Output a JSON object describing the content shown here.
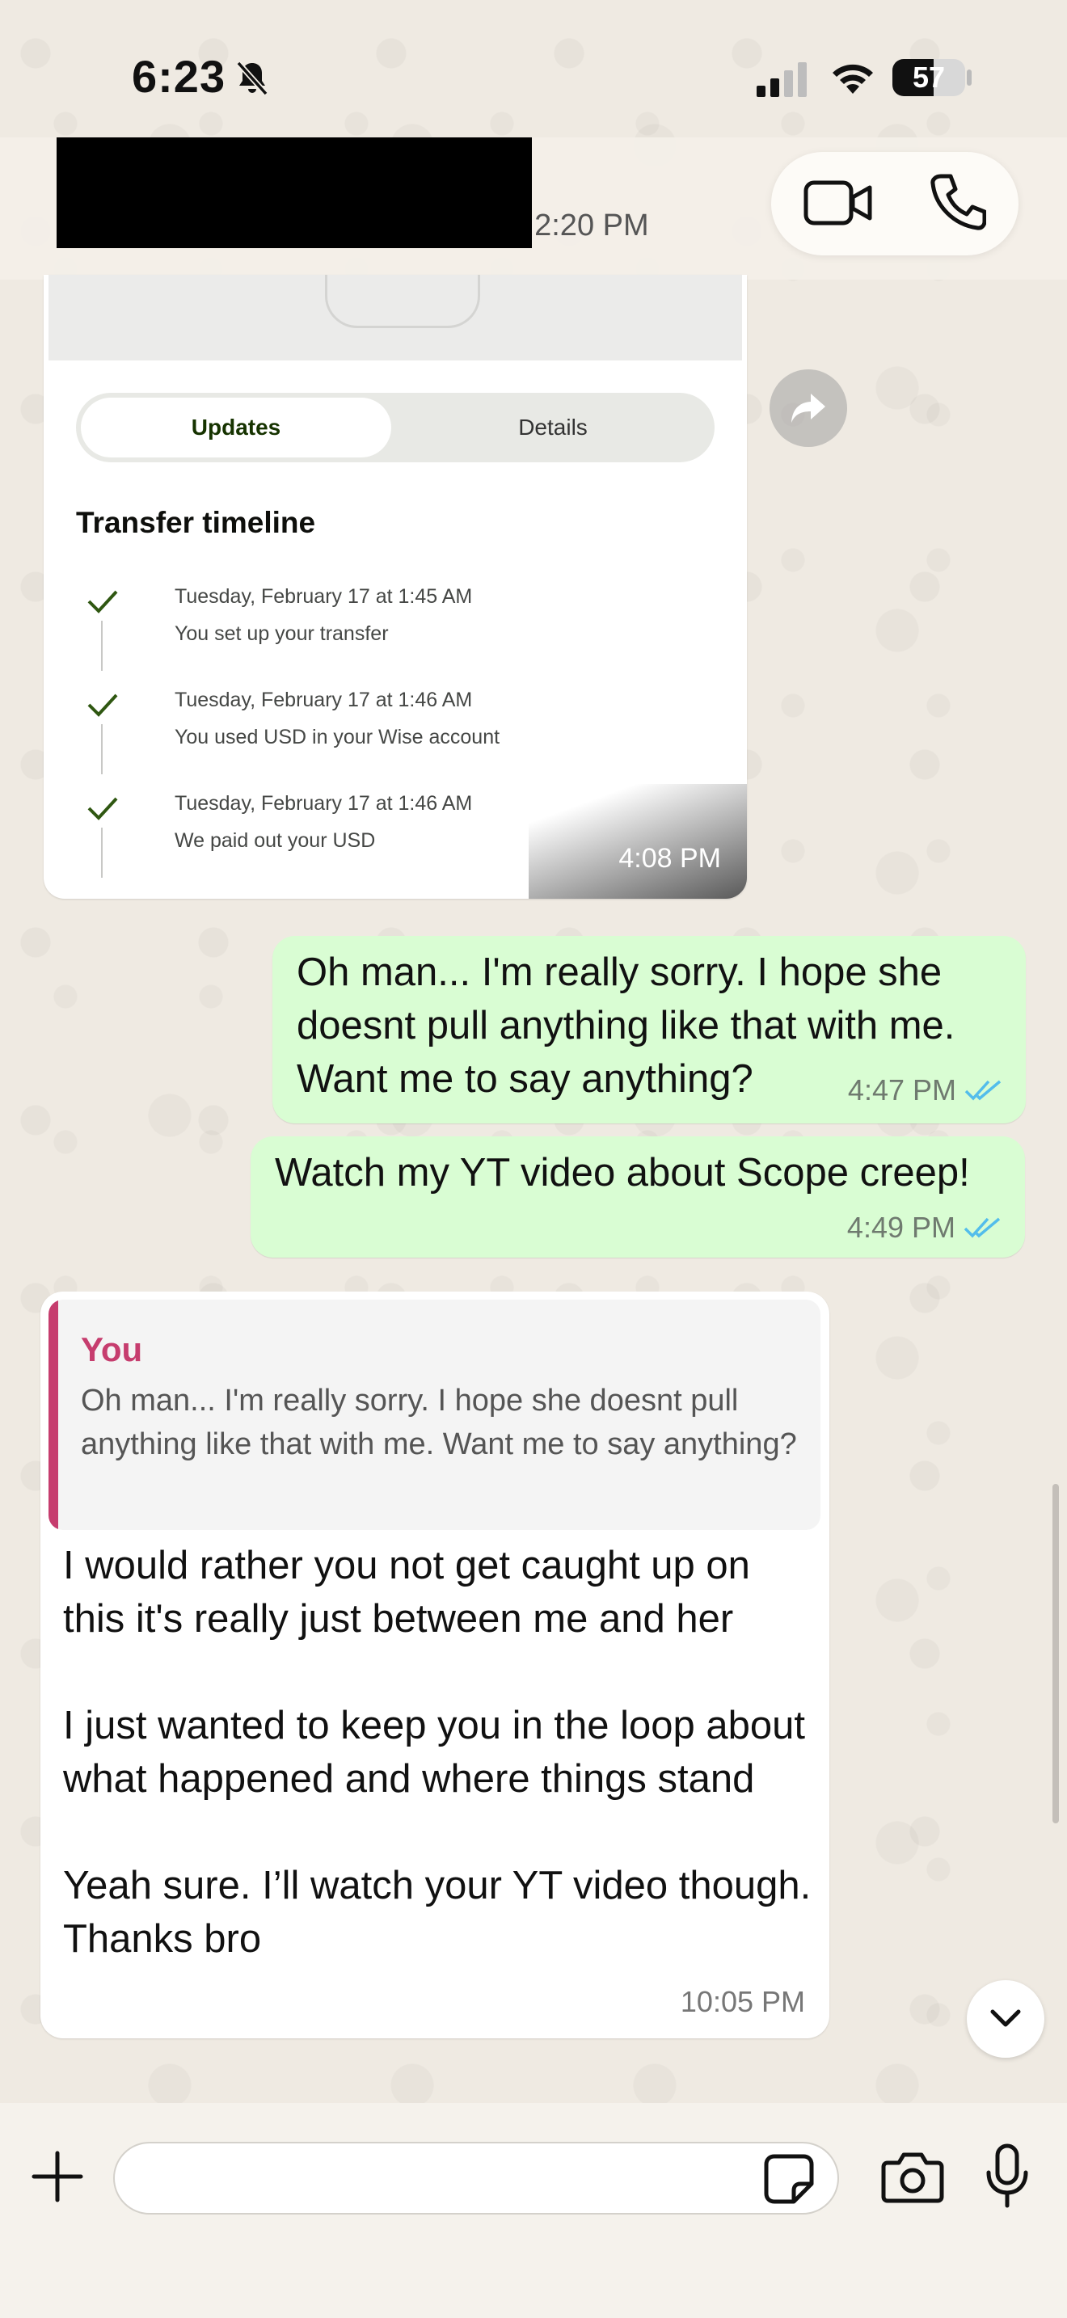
{
  "status_bar": {
    "time": "6:23",
    "battery_level": "57",
    "icons": [
      "bell-slash-icon",
      "cellular-signal-icon",
      "wifi-icon",
      "battery-icon"
    ]
  },
  "header": {
    "last_seen_partial": "t 2:20 PM",
    "icons": [
      "video-call-icon",
      "phone-call-icon"
    ]
  },
  "messages": {
    "image_message": {
      "tabs": [
        "Updates",
        "Details"
      ],
      "active_tab": "Updates",
      "timeline_title": "Transfer timeline",
      "timeline": [
        {
          "date": "Tuesday, February 17 at 1:45 AM",
          "desc": "You set up your transfer"
        },
        {
          "date": "Tuesday, February 17 at 1:46 AM",
          "desc": "You used USD in your Wise account"
        },
        {
          "date": "Tuesday, February 17 at 1:46 AM",
          "desc": "We paid out your USD"
        }
      ],
      "time": "4:08 PM"
    },
    "outgoing_1": {
      "text": "Oh man... I'm really sorry. I hope she doesnt pull anything like that with me. Want me to say anything?",
      "time": "4:47 PM"
    },
    "outgoing_2": {
      "text": "Watch my YT video about Scope creep!",
      "time": "4:49 PM"
    },
    "incoming_reply": {
      "quote_author": "You",
      "quote_text": "Oh man... I'm really sorry. I hope she doesnt pull anything like that with me. Want me to say anything?",
      "text": "I would rather you not get caught up on this it's really just between me and her\n\nI just wanted to keep you in the loop about what happened and where things stand\n\nYeah sure. I’ll watch your YT video though. Thanks bro",
      "time": "10:05 PM"
    }
  },
  "composer": {
    "placeholder": "",
    "icons": [
      "plus-icon",
      "sticker-icon",
      "camera-icon",
      "microphone-icon"
    ]
  },
  "colors": {
    "outgoing_bubble": "#d9fdd3",
    "read_ticks": "#53bdeb",
    "quote_accent": "#c63d6e",
    "wise_green": "#163300"
  }
}
